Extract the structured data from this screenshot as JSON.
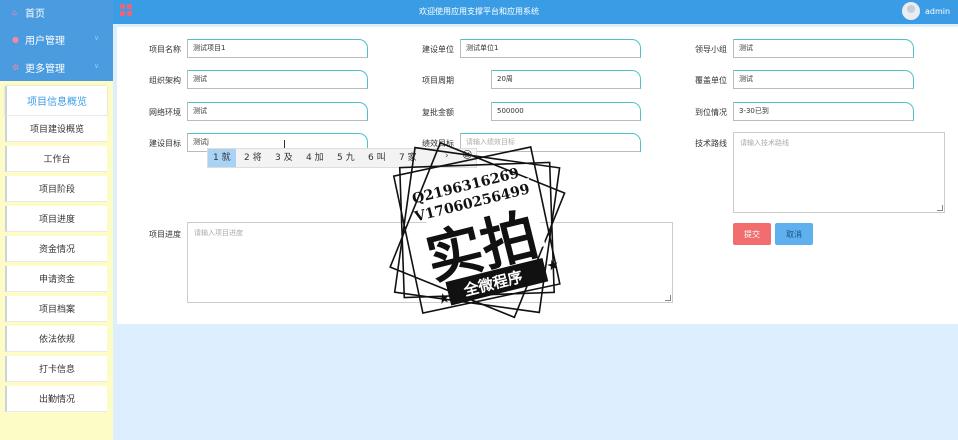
{
  "header": {
    "title": "欢迎使用应用支撑平台和应用系统",
    "user": "admin"
  },
  "sidebar": {
    "nav": [
      {
        "label": "首页",
        "icon": "home-icon"
      },
      {
        "label": "用户管理",
        "icon": "user-icon"
      },
      {
        "label": "更多管理",
        "icon": "settings-icon"
      }
    ],
    "section_title": "项目信息概览",
    "items": [
      "项目建设概览",
      "工作台",
      "项目阶段",
      "项目进度",
      "资金情况",
      "申请资金",
      "项目档案",
      "依法依规",
      "打卡信息",
      "出勤情况"
    ]
  },
  "form": {
    "project_name": {
      "label": "项目名称",
      "value": "测试项目1"
    },
    "org": {
      "label": "建设单位",
      "value": "测试单位1"
    },
    "leader": {
      "label": "领导小组",
      "value": "测试"
    },
    "structure": {
      "label": "组织架构",
      "value": "测试"
    },
    "period": {
      "label": "项目周期",
      "value": "20周"
    },
    "coverage": {
      "label": "覆盖单位",
      "value": "测试"
    },
    "network": {
      "label": "网络环境",
      "value": "测试"
    },
    "amount": {
      "label": "复批金额",
      "value": "500000"
    },
    "arrival": {
      "label": "到位情况",
      "value": "3-30已到"
    },
    "goal": {
      "label": "建设目标",
      "value": "测试j"
    },
    "perf": {
      "label": "绩效目标",
      "placeholder": "请输入绩效目标"
    },
    "tech": {
      "label": "技术路线",
      "placeholder": "请输入技术路线"
    },
    "progress": {
      "label": "项目进度",
      "placeholder": "请输入项目进度"
    }
  },
  "buttons": {
    "submit": "提交",
    "cancel": "取消"
  },
  "ime": {
    "candidates": [
      "1 就",
      "2 将",
      "3 及",
      "4 加",
      "5 九",
      "6 叫",
      "7 家"
    ],
    "emoji": "☺"
  },
  "stamp": {
    "line1": "Q2196316269",
    "line2": "V17060256499",
    "main": "实拍",
    "banner": "全微程序"
  }
}
